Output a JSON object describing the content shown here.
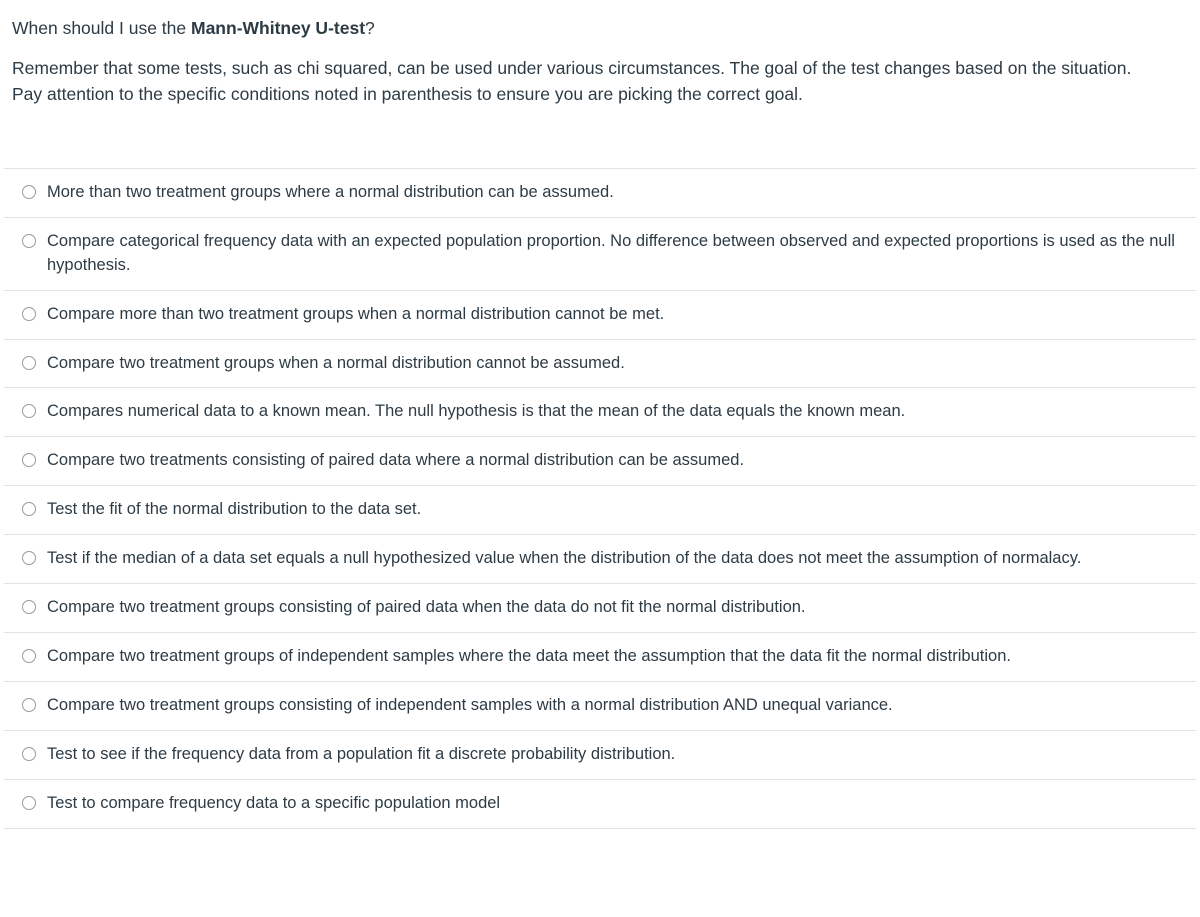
{
  "question": {
    "header_prefix": "When should I use the ",
    "header_emphasis": "Mann-Whitney U-test",
    "header_suffix": "?",
    "body": "Remember that some tests, such as chi squared, can be used under various circumstances. The goal of the test changes based on the situation. Pay attention to the specific conditions noted in parenthesis to ensure you are picking the correct goal."
  },
  "answers": {
    "input_type": "radio",
    "selected_index": null,
    "options": [
      {
        "label": "More than two treatment groups where a normal distribution can be assumed."
      },
      {
        "label": "Compare categorical frequency data with an expected population proportion. No difference between observed and expected proportions is used as the null hypothesis."
      },
      {
        "label": "Compare more than two treatment groups when a normal distribution cannot be met."
      },
      {
        "label": "Compare two treatment groups when a normal distribution cannot be assumed."
      },
      {
        "label": "Compares numerical data to a known mean. The null hypothesis is that the mean of the data equals the known mean."
      },
      {
        "label": "Compare two treatments consisting of paired data where a normal distribution can be assumed."
      },
      {
        "label": "Test the fit of the normal distribution to the data set."
      },
      {
        "label": "Test if the median of a data set equals a null hypothesized value when the distribution of the data does not meet the assumption of normalacy."
      },
      {
        "label": "Compare two treatment groups consisting of paired data when the data do not fit the normal distribution."
      },
      {
        "label": "Compare two treatment groups of independent samples where the data meet the assumption that the data fit the normal distribution."
      },
      {
        "label": "Compare two treatment groups consisting of independent samples with a normal distribution AND unequal variance."
      },
      {
        "label": "Test to see if the frequency data from a population fit a discrete probability distribution."
      },
      {
        "label": "Test to compare frequency data to a specific population model"
      }
    ]
  },
  "colors": {
    "text": "#2d3b45",
    "divider": "#e4e4e4",
    "radio_border": "#9a9a9a",
    "background": "#ffffff"
  }
}
